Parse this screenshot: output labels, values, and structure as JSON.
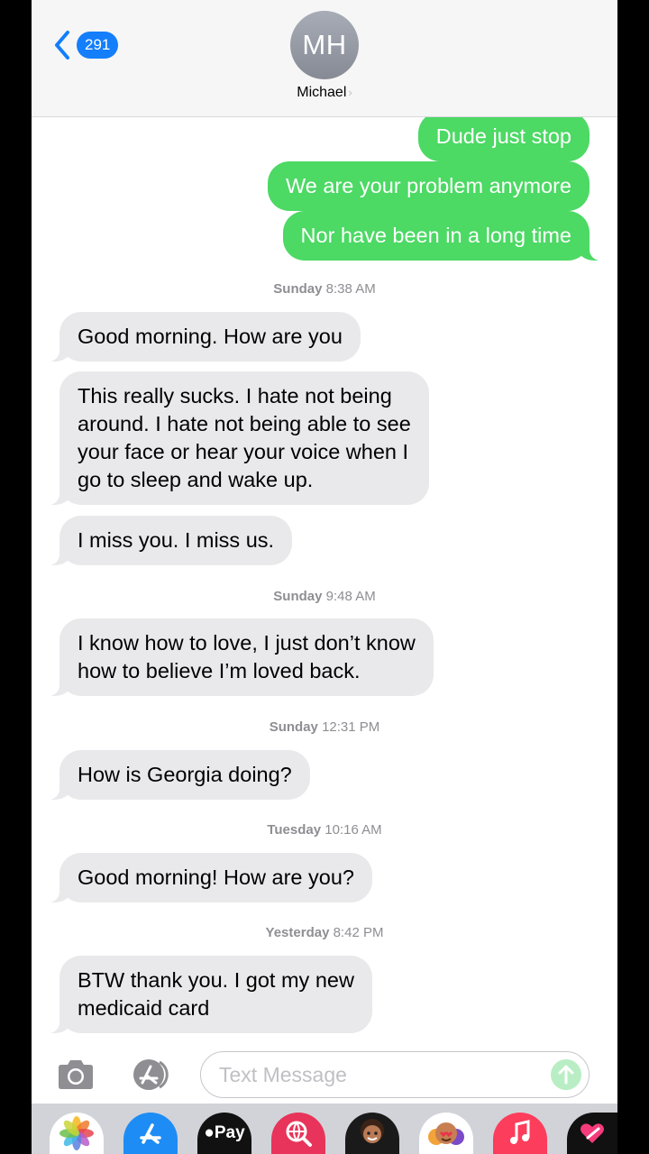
{
  "header": {
    "back_count": "291",
    "avatar_initials": "MH",
    "contact_name": "Michael",
    "contact_chevron": "›"
  },
  "thread": {
    "outgoing": [
      {
        "text": "Dude just stop"
      },
      {
        "text": "We are your problem anymore"
      },
      {
        "text": "Nor have been in a long time"
      }
    ],
    "timestamps": [
      {
        "day": "Sunday",
        "time": "8:38 AM"
      },
      {
        "day": "Sunday",
        "time": "9:48 AM"
      },
      {
        "day": "Sunday",
        "time": "12:31 PM"
      },
      {
        "day": "Tuesday",
        "time": "10:16 AM"
      },
      {
        "day": "Yesterday",
        "time": "8:42 PM"
      }
    ],
    "incoming": [
      {
        "lines": [
          "Good morning. How are you"
        ]
      },
      {
        "lines": [
          "This really sucks. I hate not being",
          "around. I hate not being able to see",
          "your face or hear your voice when I",
          "go to sleep and wake up."
        ]
      },
      {
        "lines": [
          "I miss you. I miss us."
        ]
      },
      {
        "lines": [
          "I know how to love, I just don’t know",
          "how to believe I’m loved back."
        ]
      },
      {
        "lines": [
          "How is Georgia doing?"
        ]
      },
      {
        "lines": [
          "Good morning! How are you?"
        ]
      },
      {
        "lines": [
          "BTW thank you. I got my new",
          "medicaid card"
        ]
      }
    ]
  },
  "input": {
    "placeholder": "Text Message"
  },
  "app_strip": {
    "apps": [
      "photos-icon",
      "app-store-icon",
      "apple-pay-icon",
      "web-images-icon",
      "memoji-icon",
      "animoji-icon",
      "music-icon",
      "digital-touch-icon"
    ],
    "apple_pay_label": "Pay"
  },
  "colors": {
    "outgoing_bubble": "#4cd964",
    "incoming_bubble": "#e9e9eb",
    "badge": "#147efb",
    "timestamp": "#8e8e93"
  }
}
